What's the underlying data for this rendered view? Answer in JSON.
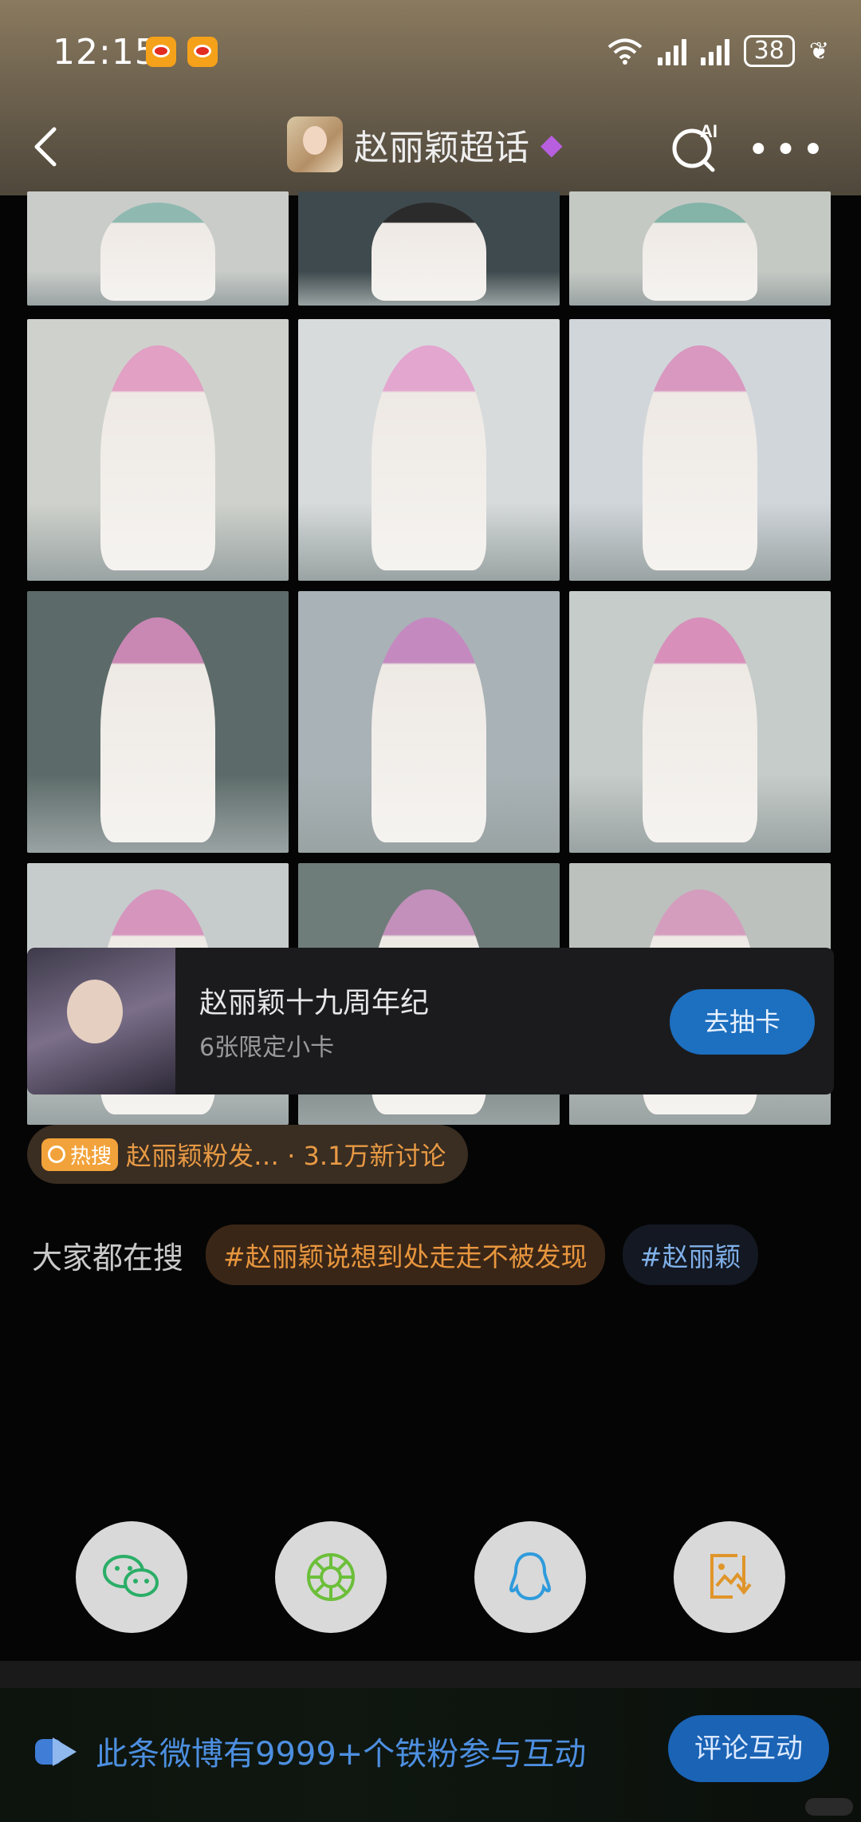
{
  "status_bar": {
    "time": "12:15",
    "battery": "38"
  },
  "nav": {
    "title": "赵丽颖超话",
    "ai_label": "AI"
  },
  "photos": [
    {
      "bg": "#c9ccc9",
      "accent": "#8fb9b0"
    },
    {
      "bg": "#3f4a4e",
      "accent": "#2b2b2b"
    },
    {
      "bg": "#c5c9c4",
      "accent": "#84b3a7"
    },
    {
      "bg": "#cfd2cc",
      "accent": "#e1a0c4"
    },
    {
      "bg": "#d7dbdc",
      "accent": "#e3a6cf"
    },
    {
      "bg": "#d1d6db",
      "accent": "#d998bf"
    },
    {
      "bg": "#5c6b69",
      "accent": "#c987b4"
    },
    {
      "bg": "#a9b2b6",
      "accent": "#c48ac0"
    },
    {
      "bg": "#c6ccc9",
      "accent": "#d890bb"
    },
    {
      "bg": "#c6cccc",
      "accent": "#d695bd"
    },
    {
      "bg": "#6f7d7a",
      "accent": "#c290ba"
    },
    {
      "bg": "#bcc1bd",
      "accent": "#d49dbd"
    }
  ],
  "card": {
    "title": "赵丽颖十九周年纪",
    "subtitle": "6张限定小卡",
    "button": "去抽卡"
  },
  "hot": {
    "badge": "热搜",
    "text": "赵丽颖粉发… · 3.1万新讨论"
  },
  "search": {
    "label": "大家都在搜",
    "tags": [
      "#赵丽颖说想到处走走不被发现",
      "#赵丽颖"
    ]
  },
  "share_icons": [
    "wechat-icon",
    "moments-icon",
    "qq-icon",
    "save-image-icon"
  ],
  "bottom": {
    "text": "此条微博有9999+个铁粉参与互动",
    "button": "评论互动"
  }
}
